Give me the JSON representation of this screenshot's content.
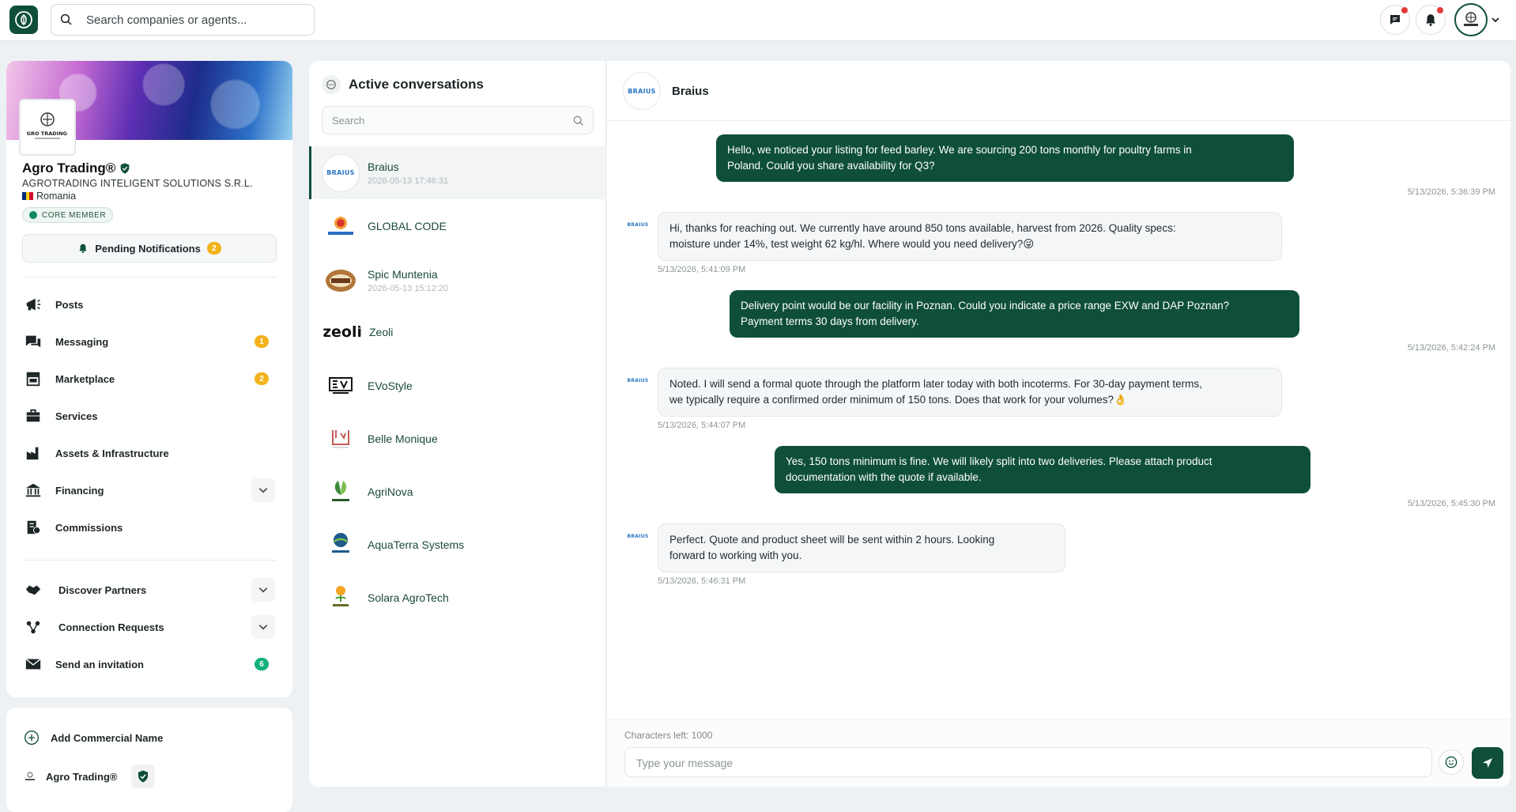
{
  "topbar": {
    "search_placeholder": "Search companies or agents...",
    "accent": "#0f4f3a",
    "notification_dot_color": "#e23b3b"
  },
  "profile": {
    "name": "Agro Trading®",
    "legal_name": "AGROTRADING INTELIGENT SOLUTIONS S.R.L.",
    "country": "Romania",
    "badge": "CORE MEMBER",
    "pending_label": "Pending Notifications",
    "pending_count": "2",
    "logo_text": "AGRO TRADING®"
  },
  "nav": {
    "items": [
      {
        "label": "Posts",
        "icon": "megaphone-icon"
      },
      {
        "label": "Messaging",
        "icon": "chat-icon",
        "badge": "1"
      },
      {
        "label": "Marketplace",
        "icon": "store-icon",
        "badge": "2"
      },
      {
        "label": "Services",
        "icon": "briefcase-icon"
      },
      {
        "label": "Assets & Infrastructure",
        "icon": "factory-icon"
      },
      {
        "label": "Financing",
        "icon": "bank-icon"
      },
      {
        "label": "Commissions",
        "icon": "receipt-icon"
      }
    ],
    "secondary": [
      {
        "label": "Discover Partners",
        "icon": "handshake-icon"
      },
      {
        "label": "Connection Requests",
        "icon": "network-icon"
      },
      {
        "label": "Send an invitation",
        "icon": "envelope-icon",
        "badge": "6"
      }
    ]
  },
  "commercial": {
    "add_label": "Add Commercial Name",
    "name": "Agro Trading®"
  },
  "conversations": {
    "title": "Active conversations",
    "search_placeholder": "Search",
    "items": [
      {
        "name": "Braius",
        "time": "2026-05-13 17:46:31",
        "logo": "BRAIUS"
      },
      {
        "name": "GLOBAL CODE"
      },
      {
        "name": "Spic Muntenia",
        "time": "2026-05-13 15:12:20"
      },
      {
        "name": "Zeoli",
        "logo": "zeoli"
      },
      {
        "name": "EVoStyle"
      },
      {
        "name": "Belle Monique"
      },
      {
        "name": "AgriNova"
      },
      {
        "name": "AquaTerra Systems"
      },
      {
        "name": "Solara AgroTech"
      }
    ]
  },
  "chat": {
    "contact": "Braius",
    "contact_logo": "BRAIUS",
    "messages": [
      {
        "dir": "out",
        "line1": "Hello, we noticed your listing for feed barley. We are sourcing 200 tons monthly for poultry farms in",
        "line2": "Poland. Could you share availability for Q3?",
        "time": "5/13/2026, 5:36:39 PM"
      },
      {
        "dir": "in",
        "line1": "Hi, thanks for reaching out. We currently have around 850 tons available, harvest from 2026. Quality specs:",
        "line2": "moisture under 14%, test weight 62 kg/hl. Where would you need delivery?😜",
        "time": "5/13/2026, 5:41:09 PM"
      },
      {
        "dir": "out",
        "line1": "Delivery point would be our facility in Poznan. Could you indicate a price range EXW and DAP Poznan?",
        "line2": "Payment terms 30 days from delivery.",
        "time": "5/13/2026, 5:42:24 PM"
      },
      {
        "dir": "in",
        "line1": "Noted. I will send a formal quote through the platform later today with both incoterms. For 30-day payment terms,",
        "line2": "we typically require a confirmed order minimum of 150 tons. Does that work for your volumes?👌",
        "time": "5/13/2026, 5:44:07 PM"
      },
      {
        "dir": "out",
        "line1": "Yes, 150 tons minimum is fine. We will likely split into two deliveries. Please attach product",
        "line2": "documentation with the quote if available.",
        "time": "5/13/2026, 5:45:30 PM"
      },
      {
        "dir": "in",
        "line1": "Perfect. Quote and product sheet will be sent within 2 hours. Looking",
        "line2": "forward to working with you.",
        "time": "5/13/2026, 5:46:31 PM"
      }
    ],
    "chars_left": "Characters left: 1000",
    "input_placeholder": "Type your message"
  }
}
